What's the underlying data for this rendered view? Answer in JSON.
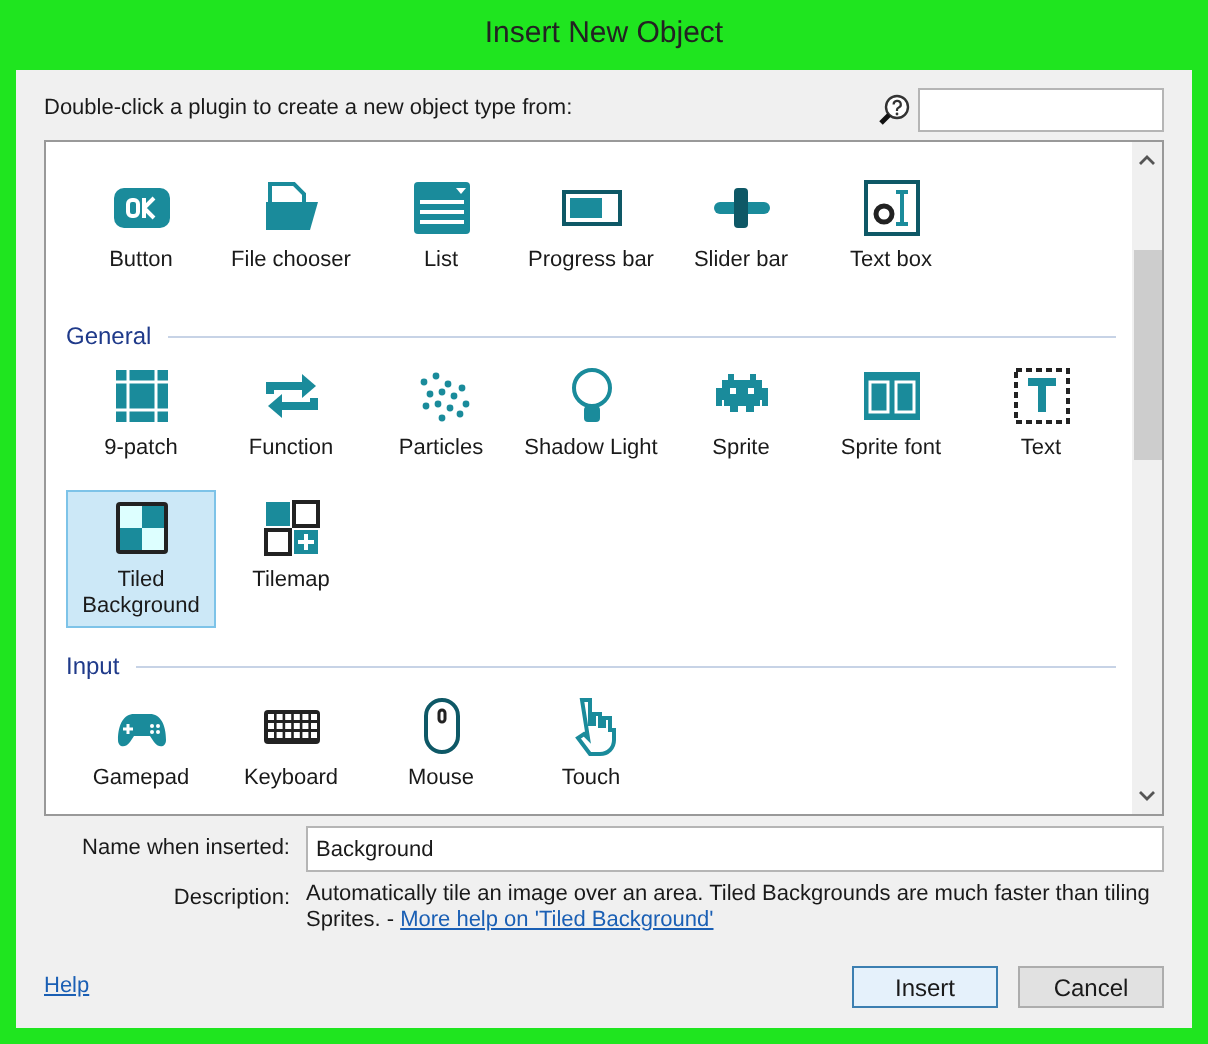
{
  "window": {
    "title": "Insert New Object"
  },
  "prompt": "Double-click a plugin to create a new object type from:",
  "groups": [
    {
      "items": [
        {
          "label": "Button",
          "selected": false
        },
        {
          "label": "File chooser",
          "selected": false
        },
        {
          "label": "List",
          "selected": false
        },
        {
          "label": "Progress bar",
          "selected": false
        },
        {
          "label": "Slider bar",
          "selected": false
        },
        {
          "label": "Text box",
          "selected": false
        }
      ]
    },
    {
      "title": "General",
      "items": [
        {
          "label": "9-patch",
          "selected": false
        },
        {
          "label": "Function",
          "selected": false
        },
        {
          "label": "Particles",
          "selected": false
        },
        {
          "label": "Shadow Light",
          "selected": false
        },
        {
          "label": "Sprite",
          "selected": false
        },
        {
          "label": "Sprite font",
          "selected": false
        },
        {
          "label": "Text",
          "selected": false
        },
        {
          "label": "Tiled Background",
          "selected": true
        },
        {
          "label": "Tilemap",
          "selected": false
        }
      ]
    },
    {
      "title": "Input",
      "items": [
        {
          "label": "Gamepad",
          "selected": false
        },
        {
          "label": "Keyboard",
          "selected": false
        },
        {
          "label": "Mouse",
          "selected": false
        },
        {
          "label": "Touch",
          "selected": false
        }
      ]
    }
  ],
  "name_field": {
    "label": "Name when inserted:",
    "value": "Background"
  },
  "description": {
    "label": "Description:",
    "text": "Automatically tile an image over an area.  Tiled Backgrounds are much faster than tiling Sprites. - ",
    "link": "More help on 'Tiled Background'"
  },
  "help_link": "Help",
  "buttons": [
    {
      "label": "Insert",
      "kind": "default"
    },
    {
      "label": "Cancel",
      "kind": "normal"
    }
  ]
}
